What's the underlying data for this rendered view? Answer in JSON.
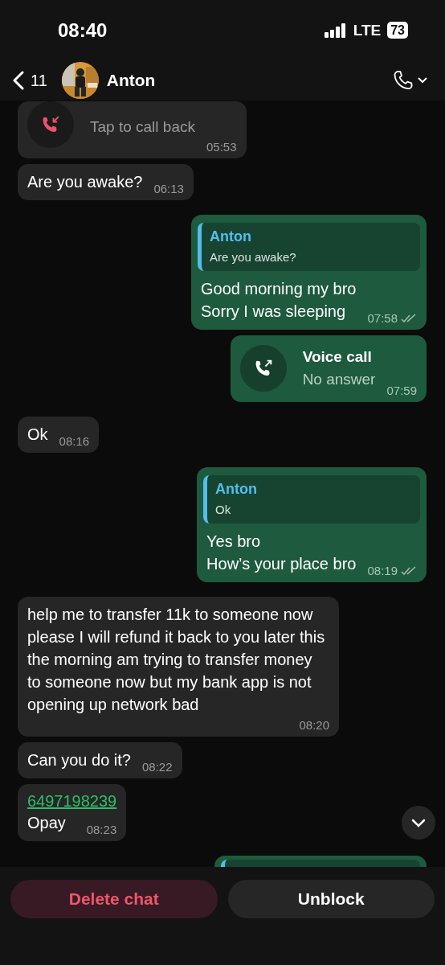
{
  "status_bar": {
    "time": "08:40",
    "network": "LTE",
    "battery": "73"
  },
  "header": {
    "back_count": "11",
    "contact": "Anton"
  },
  "messages": [
    {
      "kind": "call",
      "outgoing": false,
      "missed": true,
      "subtitle": "Tap to call back",
      "time": "05:53"
    },
    {
      "kind": "text",
      "outgoing": false,
      "text": "Are you awake?",
      "time": "06:13"
    },
    {
      "kind": "reply",
      "outgoing": true,
      "quote_author": "Anton",
      "quote_text": "Are you awake?",
      "text": "Good morning my bro\nSorry I was sleeping",
      "time": "07:58",
      "read": true
    },
    {
      "kind": "call",
      "outgoing": true,
      "missed": false,
      "title": "Voice call",
      "subtitle": "No answer",
      "time": "07:59"
    },
    {
      "kind": "text",
      "outgoing": false,
      "text": "Ok",
      "time": "08:16"
    },
    {
      "kind": "reply",
      "outgoing": true,
      "quote_author": "Anton",
      "quote_text": "Ok",
      "text": "Yes bro\nHow’s your place bro",
      "time": "08:19",
      "read": true
    },
    {
      "kind": "text",
      "outgoing": false,
      "text": "help me to transfer 11k to someone now please I will refund it back to you later this the morning am trying to transfer money to someone now but my bank app is not opening up network bad",
      "time": "08:20"
    },
    {
      "kind": "text",
      "outgoing": false,
      "text": "Can you do it?",
      "time": "08:22"
    },
    {
      "kind": "link",
      "outgoing": false,
      "link": "6497198239",
      "text": "Opay",
      "time": "08:23"
    },
    {
      "kind": "partial",
      "outgoing": true
    }
  ],
  "actions": [
    {
      "label": "Delete chat",
      "kind": "danger"
    },
    {
      "label": "Unblock",
      "kind": "normal"
    }
  ]
}
